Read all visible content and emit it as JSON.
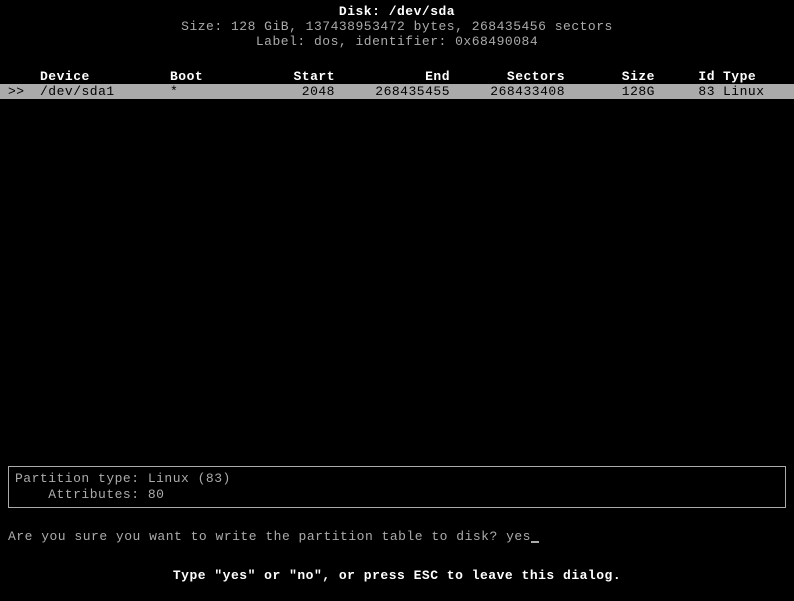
{
  "header": {
    "disk_label": "Disk: /dev/sda",
    "size_line": "Size: 128 GiB, 137438953472 bytes, 268435456 sectors",
    "label_line": "Label: dos, identifier: 0x68490084"
  },
  "columns": {
    "device": "Device",
    "boot": "Boot",
    "start": "Start",
    "end": "End",
    "sectors": "Sectors",
    "size": "Size",
    "id": "Id",
    "type": "Type"
  },
  "partitions": [
    {
      "marker": ">>",
      "device": "/dev/sda1",
      "boot": "*",
      "start": "2048",
      "end": "268435455",
      "sectors": "268433408",
      "size": "128G",
      "id": "83",
      "type": "Linux",
      "selected": true
    }
  ],
  "info": {
    "partition_type": "Partition type: Linux (83)",
    "attributes": "    Attributes: 80"
  },
  "prompt": {
    "question": "Are you sure you want to write the partition table to disk? ",
    "input": "yes"
  },
  "footer": "Type \"yes\" or \"no\", or press ESC to leave this dialog."
}
